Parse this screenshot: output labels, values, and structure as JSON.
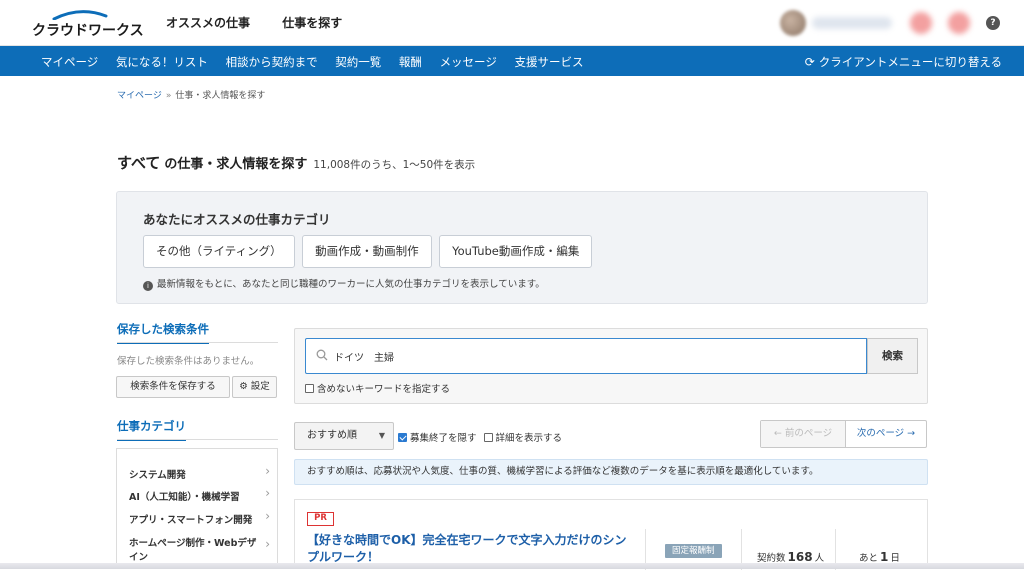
{
  "header": {
    "logo": "クラウドワークス",
    "nav": [
      "オススメの仕事",
      "仕事を探す"
    ],
    "help": "?"
  },
  "subnav": {
    "items": [
      "マイページ",
      "気になる！リスト",
      "相談から契約まで",
      "契約一覧",
      "報酬",
      "メッセージ",
      "支援サービス"
    ],
    "switch_label": "クライアントメニューに切り替える"
  },
  "breadcrumb": {
    "home": "マイページ",
    "separator": "»",
    "current": "仕事・求人情報を探す"
  },
  "title": {
    "scope": "すべて",
    "main": "の仕事・求人情報を探す",
    "count": "11,008件のうち、1〜50件を表示"
  },
  "recommend": {
    "heading": "あなたにオススメの仕事カテゴリ",
    "chips": [
      "その他（ライティング）",
      "動画作成・動画制作",
      "YouTube動画作成・編集"
    ],
    "note": "最新情報をもとに、あなたと同じ職種のワーカーに人気の仕事カテゴリを表示しています。"
  },
  "saved_search": {
    "heading": "保存した検索条件",
    "empty": "保存した検索条件はありません。",
    "save_button": "検索条件を保存する",
    "settings_button": "設定"
  },
  "categories": {
    "heading": "仕事カテゴリ",
    "items": [
      "システム開発",
      "AI（人工知能）・機械学習",
      "アプリ・スマートフォン開発",
      "ホームページ制作・Webデザイン"
    ]
  },
  "search": {
    "query": "ドイツ　主婦",
    "button": "検索",
    "exclude_label": "含めないキーワードを指定する"
  },
  "sort": {
    "selected": "おすすめ順",
    "hide_closed": "募集終了を隠す",
    "show_details": "詳細を表示する",
    "prev_page": "← 前のページ",
    "next_page": "次のページ →",
    "note": "おすすめ順は、応募状況や人気度、仕事の質、機械学習による評価など複数のデータを基に表示順を最適化しています。"
  },
  "job": {
    "badge": "PR",
    "title": "【好きな時間でOK】完全在宅ワークで文字入力だけのシンプルワーク！",
    "pay_type": "固定報酬制",
    "contracts_label": "契約数",
    "contracts_value": "168",
    "contracts_unit": "人",
    "remaining_label": "あと",
    "remaining_value": "1",
    "remaining_unit": "日"
  },
  "colors": {
    "brand_blue": "#0d6db8",
    "link_blue": "#1d5fa8",
    "pr_red": "#d33333"
  }
}
